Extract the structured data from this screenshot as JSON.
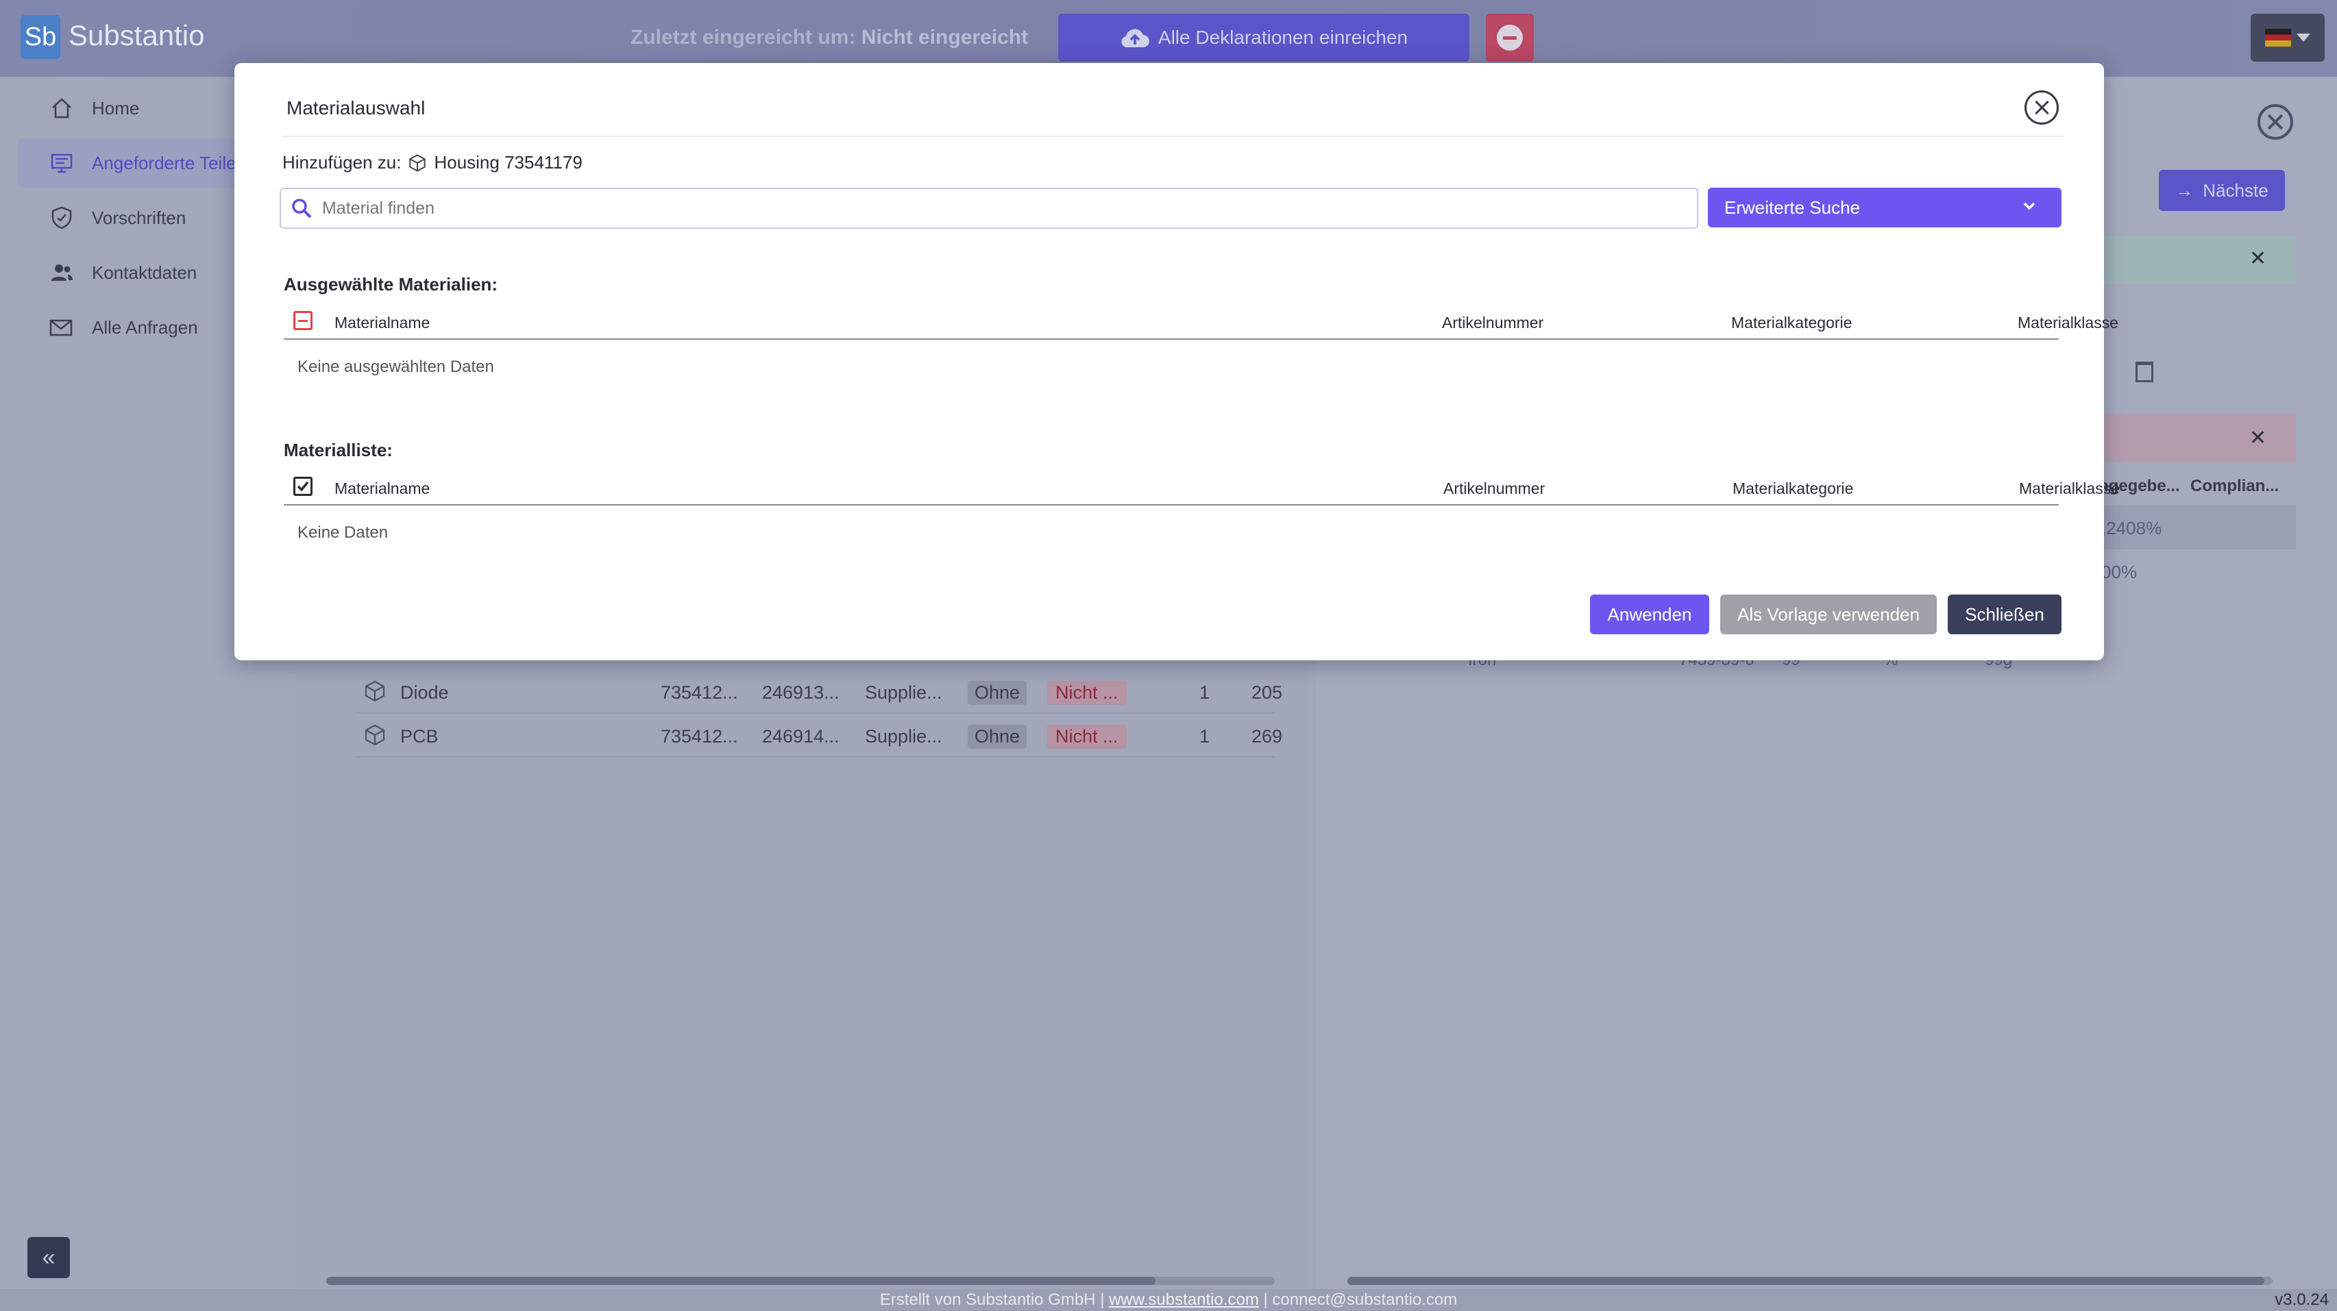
{
  "app": {
    "logo_mark": "Sb",
    "logo_name": "Substantio",
    "submitted_label": "Zuletzt eingereicht um:",
    "submitted_value": "Nicht eingereicht",
    "submit_all_label": "Alle Deklarationen einreichen",
    "next_label": "Nächste",
    "version": "v3.0.24"
  },
  "sidebar": {
    "items": [
      {
        "label": "Home",
        "icon": "home-icon"
      },
      {
        "label": "Angeforderte Teile",
        "icon": "monitor-icon",
        "active": true
      },
      {
        "label": "Vorschriften",
        "icon": "shield-icon"
      },
      {
        "label": "Kontaktdaten",
        "icon": "contacts-icon"
      },
      {
        "label": "Alle Anfragen",
        "icon": "mail-icon"
      }
    ]
  },
  "background_table": {
    "rows": [
      {
        "name": "Diode",
        "c1": "735412...",
        "c2": "246913...",
        "c3": "Supplie...",
        "badge1": "Ohne",
        "badge2": "Nicht ...",
        "qty": "1",
        "last": "205"
      },
      {
        "name": "PCB",
        "c1": "735412...",
        "c2": "246914...",
        "c3": "Supplie...",
        "badge1": "Ohne",
        "badge2": "Nicht ...",
        "qty": "1",
        "last": "269"
      }
    ]
  },
  "background_right": {
    "header_given": "ngegebe...",
    "header_compliance": "Complian...",
    "row1_value": ".2408%",
    "row2_value": "00%",
    "row3_name": "Iron",
    "row3_cas": "7439-89-6",
    "row3_num": "99",
    "row3_unit": "%",
    "row3_mass": "99g"
  },
  "modal": {
    "title": "Materialauswahl",
    "add_to_label": "Hinzufügen zu:",
    "add_to_target": "Housing 73541179",
    "search_placeholder": "Material finden",
    "advanced_search_label": "Erweiterte Suche",
    "selected_section_title": "Ausgewählte Materialien:",
    "list_section_title": "Materialliste:",
    "columns": [
      "Materialname",
      "Artikelnummer",
      "Materialkategorie",
      "Materialklasse"
    ],
    "selected_empty": "Keine ausgewählten Daten",
    "list_empty": "Keine Daten",
    "apply_label": "Anwenden",
    "template_label": "Als Vorlage verwenden",
    "close_label": "Schließen"
  },
  "footer": {
    "created_by": "Erstellt von Substantio GmbH |",
    "website": "www.substantio.com",
    "email": "| connect@substantio.com"
  },
  "colors": {
    "accent": "#6b57f0",
    "danger": "#e1424e",
    "dark_button": "#3a3f5c"
  }
}
